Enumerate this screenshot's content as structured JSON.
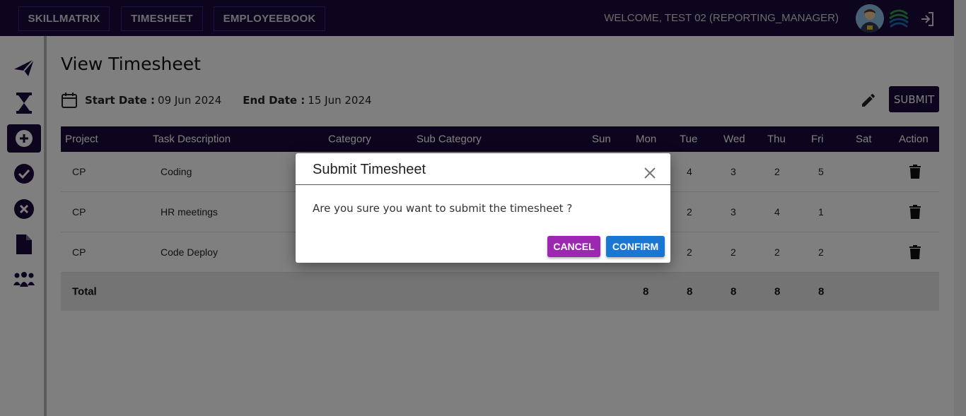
{
  "nav": {
    "items": [
      "SKILLMATRIX",
      "TIMESHEET",
      "EMPLOYEEBOOK"
    ],
    "welcome": "WELCOME, TEST 02 (REPORTING_MANAGER)"
  },
  "sidebar": {
    "items": [
      {
        "icon": "send-icon"
      },
      {
        "icon": "hourglass-icon"
      },
      {
        "icon": "add-circle-icon",
        "active": true
      },
      {
        "icon": "check-circle-icon"
      },
      {
        "icon": "cancel-circle-icon"
      },
      {
        "icon": "document-icon"
      },
      {
        "icon": "team-icon"
      }
    ]
  },
  "page": {
    "title": "View Timesheet",
    "start_label": "Start Date : ",
    "start_value": "09 Jun 2024",
    "end_label": "End Date : ",
    "end_value": "15 Jun 2024",
    "submit_label": "SUBMIT"
  },
  "table": {
    "headers": [
      "Project",
      "Task Description",
      "Category",
      "Sub Category",
      "Sun",
      "Mon",
      "Tue",
      "Wed",
      "Thu",
      "Fri",
      "Sat",
      "Action"
    ],
    "rows": [
      {
        "project": "CP",
        "task": "Coding",
        "tue": "4",
        "wed": "3",
        "thu": "2",
        "fri": "5"
      },
      {
        "project": "CP",
        "task": "HR meetings",
        "tue": "2",
        "wed": "3",
        "thu": "4",
        "fri": "1"
      },
      {
        "project": "CP",
        "task": "Code Deploy",
        "tue": "2",
        "wed": "2",
        "thu": "2",
        "fri": "2"
      }
    ],
    "total": {
      "label": "Total",
      "mon": "8",
      "tue": "8",
      "wed": "8",
      "thu": "8",
      "fri": "8"
    }
  },
  "dialog": {
    "title": "Submit Timesheet",
    "message": "Are you sure you want to submit the timesheet ?",
    "cancel_label": "CANCEL",
    "confirm_label": "CONFIRM"
  },
  "colors": {
    "brand_dark": "#1b0a3a",
    "cancel": "#9c27b0",
    "confirm": "#1976d2"
  }
}
